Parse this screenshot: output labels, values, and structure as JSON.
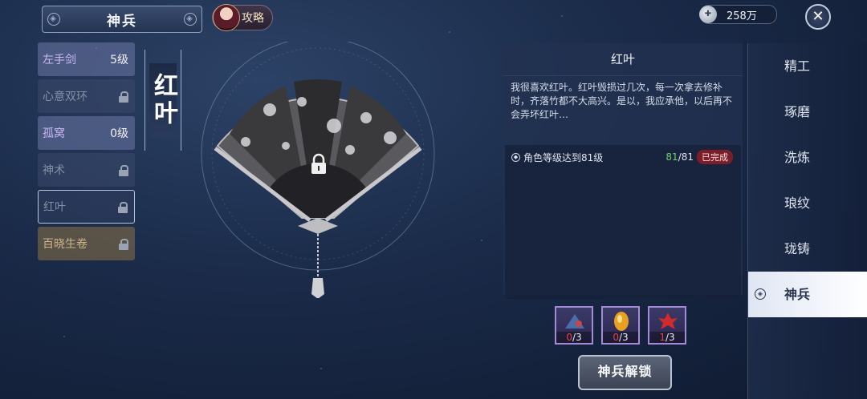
{
  "header": {
    "title": "神兵",
    "guide_label": "攻略",
    "currency_value": "258万",
    "close_glyph": "✕"
  },
  "weapon_list": [
    {
      "name": "左手剑",
      "level": "5级",
      "state": "unlocked"
    },
    {
      "name": "心意双环",
      "level": "",
      "state": "locked"
    },
    {
      "name": "孤窝",
      "level": "0级",
      "state": "unlocked"
    },
    {
      "name": "神术",
      "level": "",
      "state": "locked"
    },
    {
      "name": "红叶",
      "level": "",
      "state": "selected"
    },
    {
      "name": "百晓生卷",
      "level": "",
      "state": "gold"
    }
  ],
  "selected_weapon": {
    "vertical_name": "红叶",
    "locked": true
  },
  "detail": {
    "title": "红叶",
    "description": "我很喜欢红叶。红叶毁损过几次，每一次拿去修补时，齐落竹都不大高兴。是以，我应承他，以后再不会弄坏红叶…",
    "requirement": {
      "text": "角色等级达到81级",
      "current": "81",
      "total": "/81",
      "status": "已完成"
    }
  },
  "materials": [
    {
      "current": "0",
      "total": "/3",
      "icon": "blue-fan-material-icon"
    },
    {
      "current": "0",
      "total": "/3",
      "icon": "golden-gem-icon"
    },
    {
      "current": "1",
      "total": "/3",
      "icon": "red-leaf-icon"
    }
  ],
  "unlock_button_label": "神兵解锁",
  "tabs": [
    {
      "label": "精工",
      "active": false
    },
    {
      "label": "琢磨",
      "active": false
    },
    {
      "label": "洗炼",
      "active": false
    },
    {
      "label": "琅纹",
      "active": false
    },
    {
      "label": "珑铸",
      "active": false
    },
    {
      "label": "神兵",
      "active": true
    }
  ],
  "colors": {
    "progress_ok": "#6cd26c",
    "progress_missing": "#e04444",
    "done_badge": "#7a1e2a"
  }
}
